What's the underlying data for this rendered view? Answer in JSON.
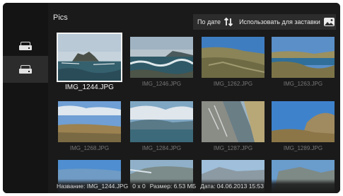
{
  "header": {
    "folder_title": "Pics",
    "sort_label": "По дате",
    "sort_icon": "sort-arrows-icon",
    "screensaver_label": "Использовать для заставки",
    "screensaver_icon": "image-icon"
  },
  "sidebar": {
    "items": [
      {
        "icon": "drive-icon",
        "active": false
      },
      {
        "icon": "drive-icon",
        "active": true
      }
    ]
  },
  "grid": {
    "items": [
      {
        "label": "IMG_1244.JPG",
        "selected": true,
        "scene": "sea-island"
      },
      {
        "label": "IMG_1246.JPG",
        "selected": false,
        "scene": "sea-waves"
      },
      {
        "label": "IMG_1262.JPG",
        "selected": false,
        "scene": "hill-sky"
      },
      {
        "label": "IMG_1263.JPG",
        "selected": false,
        "scene": "coast-cliff"
      },
      {
        "label": "IMG_1268.JPG",
        "selected": false,
        "scene": "dry-field"
      },
      {
        "label": "IMG_1284.JPG",
        "selected": false,
        "scene": "cloudy-hills"
      },
      {
        "label": "IMG_1287.JPG",
        "selected": false,
        "scene": "rocky-slope"
      },
      {
        "label": "IMG_1289.JPG",
        "selected": false,
        "scene": "rock-sky"
      },
      {
        "label": "",
        "selected": false,
        "scene": "blue-sky-partial"
      },
      {
        "label": "",
        "selected": false,
        "scene": "sea-partial"
      },
      {
        "label": "",
        "selected": false,
        "scene": "mountain-partial"
      },
      {
        "label": "",
        "selected": false,
        "scene": "rock-partial"
      }
    ]
  },
  "status": {
    "name": "Название: IMG_1244.JPG",
    "dimensions": "0 x 0",
    "size": "Размер: 6.53 МБ",
    "date": "Дата: 04.06.2013 15:53"
  },
  "colors": {
    "background": "#1a1a1a",
    "sidebar": "#141414",
    "sidebar_active": "#2c2c2c",
    "toolbar": "#2c2c2c",
    "text_primary": "#e6e6e6",
    "text_muted": "#777777"
  }
}
